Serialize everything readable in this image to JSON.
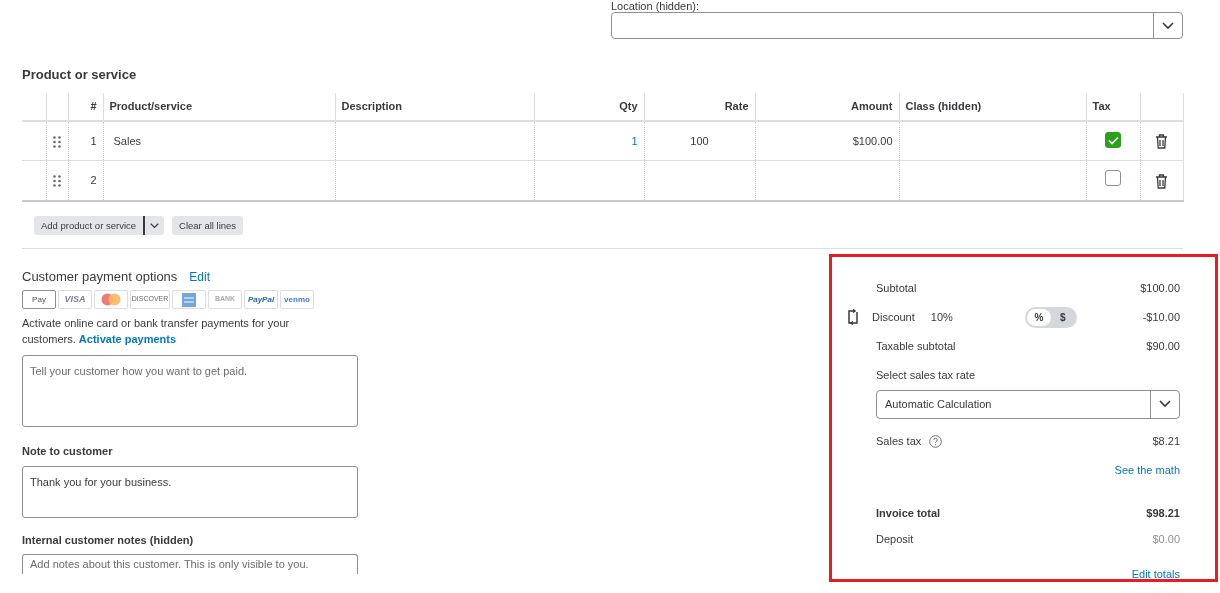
{
  "location": {
    "label": "Location (hidden):"
  },
  "products": {
    "title": "Product or service",
    "columns": [
      "#",
      "Product/service",
      "Description",
      "Qty",
      "Rate",
      "Amount",
      "Class (hidden)",
      "Tax"
    ],
    "rows": [
      {
        "number": "1",
        "product": "Sales",
        "qty": "1",
        "rate": "100",
        "amount": "$100.00",
        "tax": true
      },
      {
        "number": "2",
        "tax": false
      }
    ],
    "buttons": {
      "add": "Add product or service",
      "clear": "Clear all lines"
    }
  },
  "payment_options": {
    "title": "Customer payment options",
    "edit": "Edit",
    "methods": [
      {
        "kind": "applepay",
        "label": "Pay"
      },
      {
        "kind": "visa",
        "label": "VISA"
      },
      {
        "kind": "mastercard"
      },
      {
        "kind": "discover",
        "label": "DISCOVER"
      },
      {
        "kind": "amex"
      },
      {
        "kind": "bank",
        "label": "BANK"
      },
      {
        "kind": "paypal",
        "label": "PayPal"
      },
      {
        "kind": "venmo",
        "label": "venmo"
      }
    ],
    "text": "Activate online card or bank transfer payments for your customers.",
    "link": "Activate payments",
    "placeholder": "Tell your customer how you want to get paid."
  },
  "note": {
    "label": "Note to customer",
    "value": "Thank you for your business."
  },
  "internal_notes": {
    "label": "Internal customer notes (hidden)",
    "placeholder": "Add notes about this customer. This is only visible to you."
  },
  "totals": {
    "subtotal": {
      "label": "Subtotal",
      "value": "$100.00"
    },
    "discount": {
      "label": "Discount",
      "rate": "10%",
      "value": "-$10.00",
      "modes": [
        {
          "label": "%",
          "selected": true
        },
        {
          "label": "$",
          "selected": false
        }
      ]
    },
    "taxable": {
      "label": "Taxable subtotal",
      "value": "$90.00"
    },
    "tax_rate": {
      "label": "Select sales tax rate",
      "value": "Automatic Calculation"
    },
    "sales_tax": {
      "label": "Sales tax",
      "value": "$8.21"
    },
    "see_math": "See the math",
    "invoice_total": {
      "label": "Invoice total",
      "value": "$98.21"
    },
    "deposit": {
      "label": "Deposit",
      "value": "$0.00"
    },
    "edit_totals": "Edit totals"
  }
}
